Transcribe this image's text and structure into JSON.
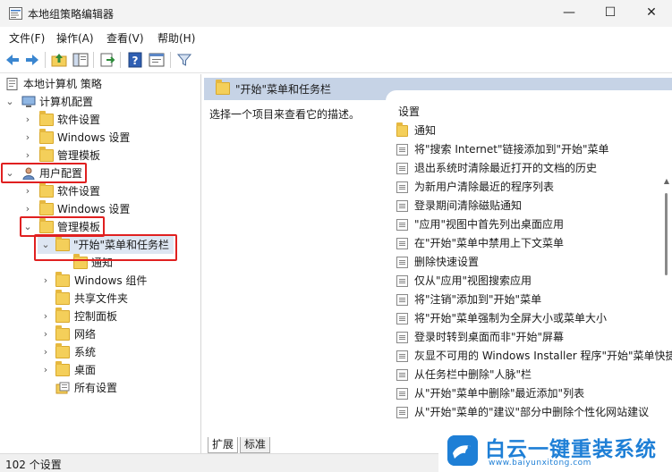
{
  "window": {
    "title": "本地组策略编辑器",
    "controls": {
      "minimize": "—",
      "maximize": "☐",
      "close": "✕"
    }
  },
  "menu": [
    "文件(F)",
    "操作(A)",
    "查看(V)",
    "帮助(H)"
  ],
  "toolbar": {
    "icons": [
      "back-arrow-icon",
      "forward-arrow-icon",
      "up-folder-icon",
      "show-hide-tree-icon",
      "export-list-icon",
      "help-icon",
      "properties-icon",
      "filter-icon"
    ]
  },
  "tree": {
    "root": "本地计算机 策略",
    "computer_config": "计算机配置",
    "computer_children": [
      "软件设置",
      "Windows 设置",
      "管理模板"
    ],
    "user_config": "用户配置",
    "user_children": [
      "软件设置",
      "Windows 设置"
    ],
    "admin_templates": "管理模板",
    "start_taskbar": "\"开始\"菜单和任务栏",
    "notifications": "通知",
    "admin_children": [
      "Windows 组件",
      "共享文件夹",
      "控制面板",
      "网络",
      "系统",
      "桌面",
      "所有设置"
    ],
    "arrows": {
      "expanded": "⌄",
      "collapsed": "›"
    }
  },
  "right": {
    "header": "\"开始\"菜单和任务栏",
    "description": "选择一个项目来查看它的描述。",
    "column_header": "设置",
    "folder_item": "通知",
    "settings": [
      "将\"搜索 Internet\"链接添加到\"开始\"菜单",
      "退出系统时清除最近打开的文档的历史",
      "为新用户清除最近的程序列表",
      "登录期间清除磁贴通知",
      "\"应用\"视图中首先列出桌面应用",
      "在\"开始\"菜单中禁用上下文菜单",
      "删除快速设置",
      "仅从\"应用\"视图搜索应用",
      "将\"注销\"添加到\"开始\"菜单",
      "将\"开始\"菜单强制为全屏大小或菜单大小",
      "登录时转到桌面而非\"开始\"屏幕",
      "灰显不可用的 Windows Installer 程序\"开始\"菜单快捷方式",
      "从任务栏中删除\"人脉\"栏",
      "从\"开始\"菜单中删除\"最近添加\"列表",
      "从\"开始\"菜单的\"建议\"部分中删除个性化网站建议"
    ],
    "tabs": [
      "扩展",
      "标准"
    ]
  },
  "status": "102 个设置",
  "watermark": {
    "title": "白云一键重装系统",
    "url": "www.baiyunxitong.com"
  },
  "colors": {
    "highlight_box": "#e02020",
    "header_bg": "#c6d3e6",
    "folder": "#f4cf5a",
    "brand": "#1e7fd6"
  }
}
